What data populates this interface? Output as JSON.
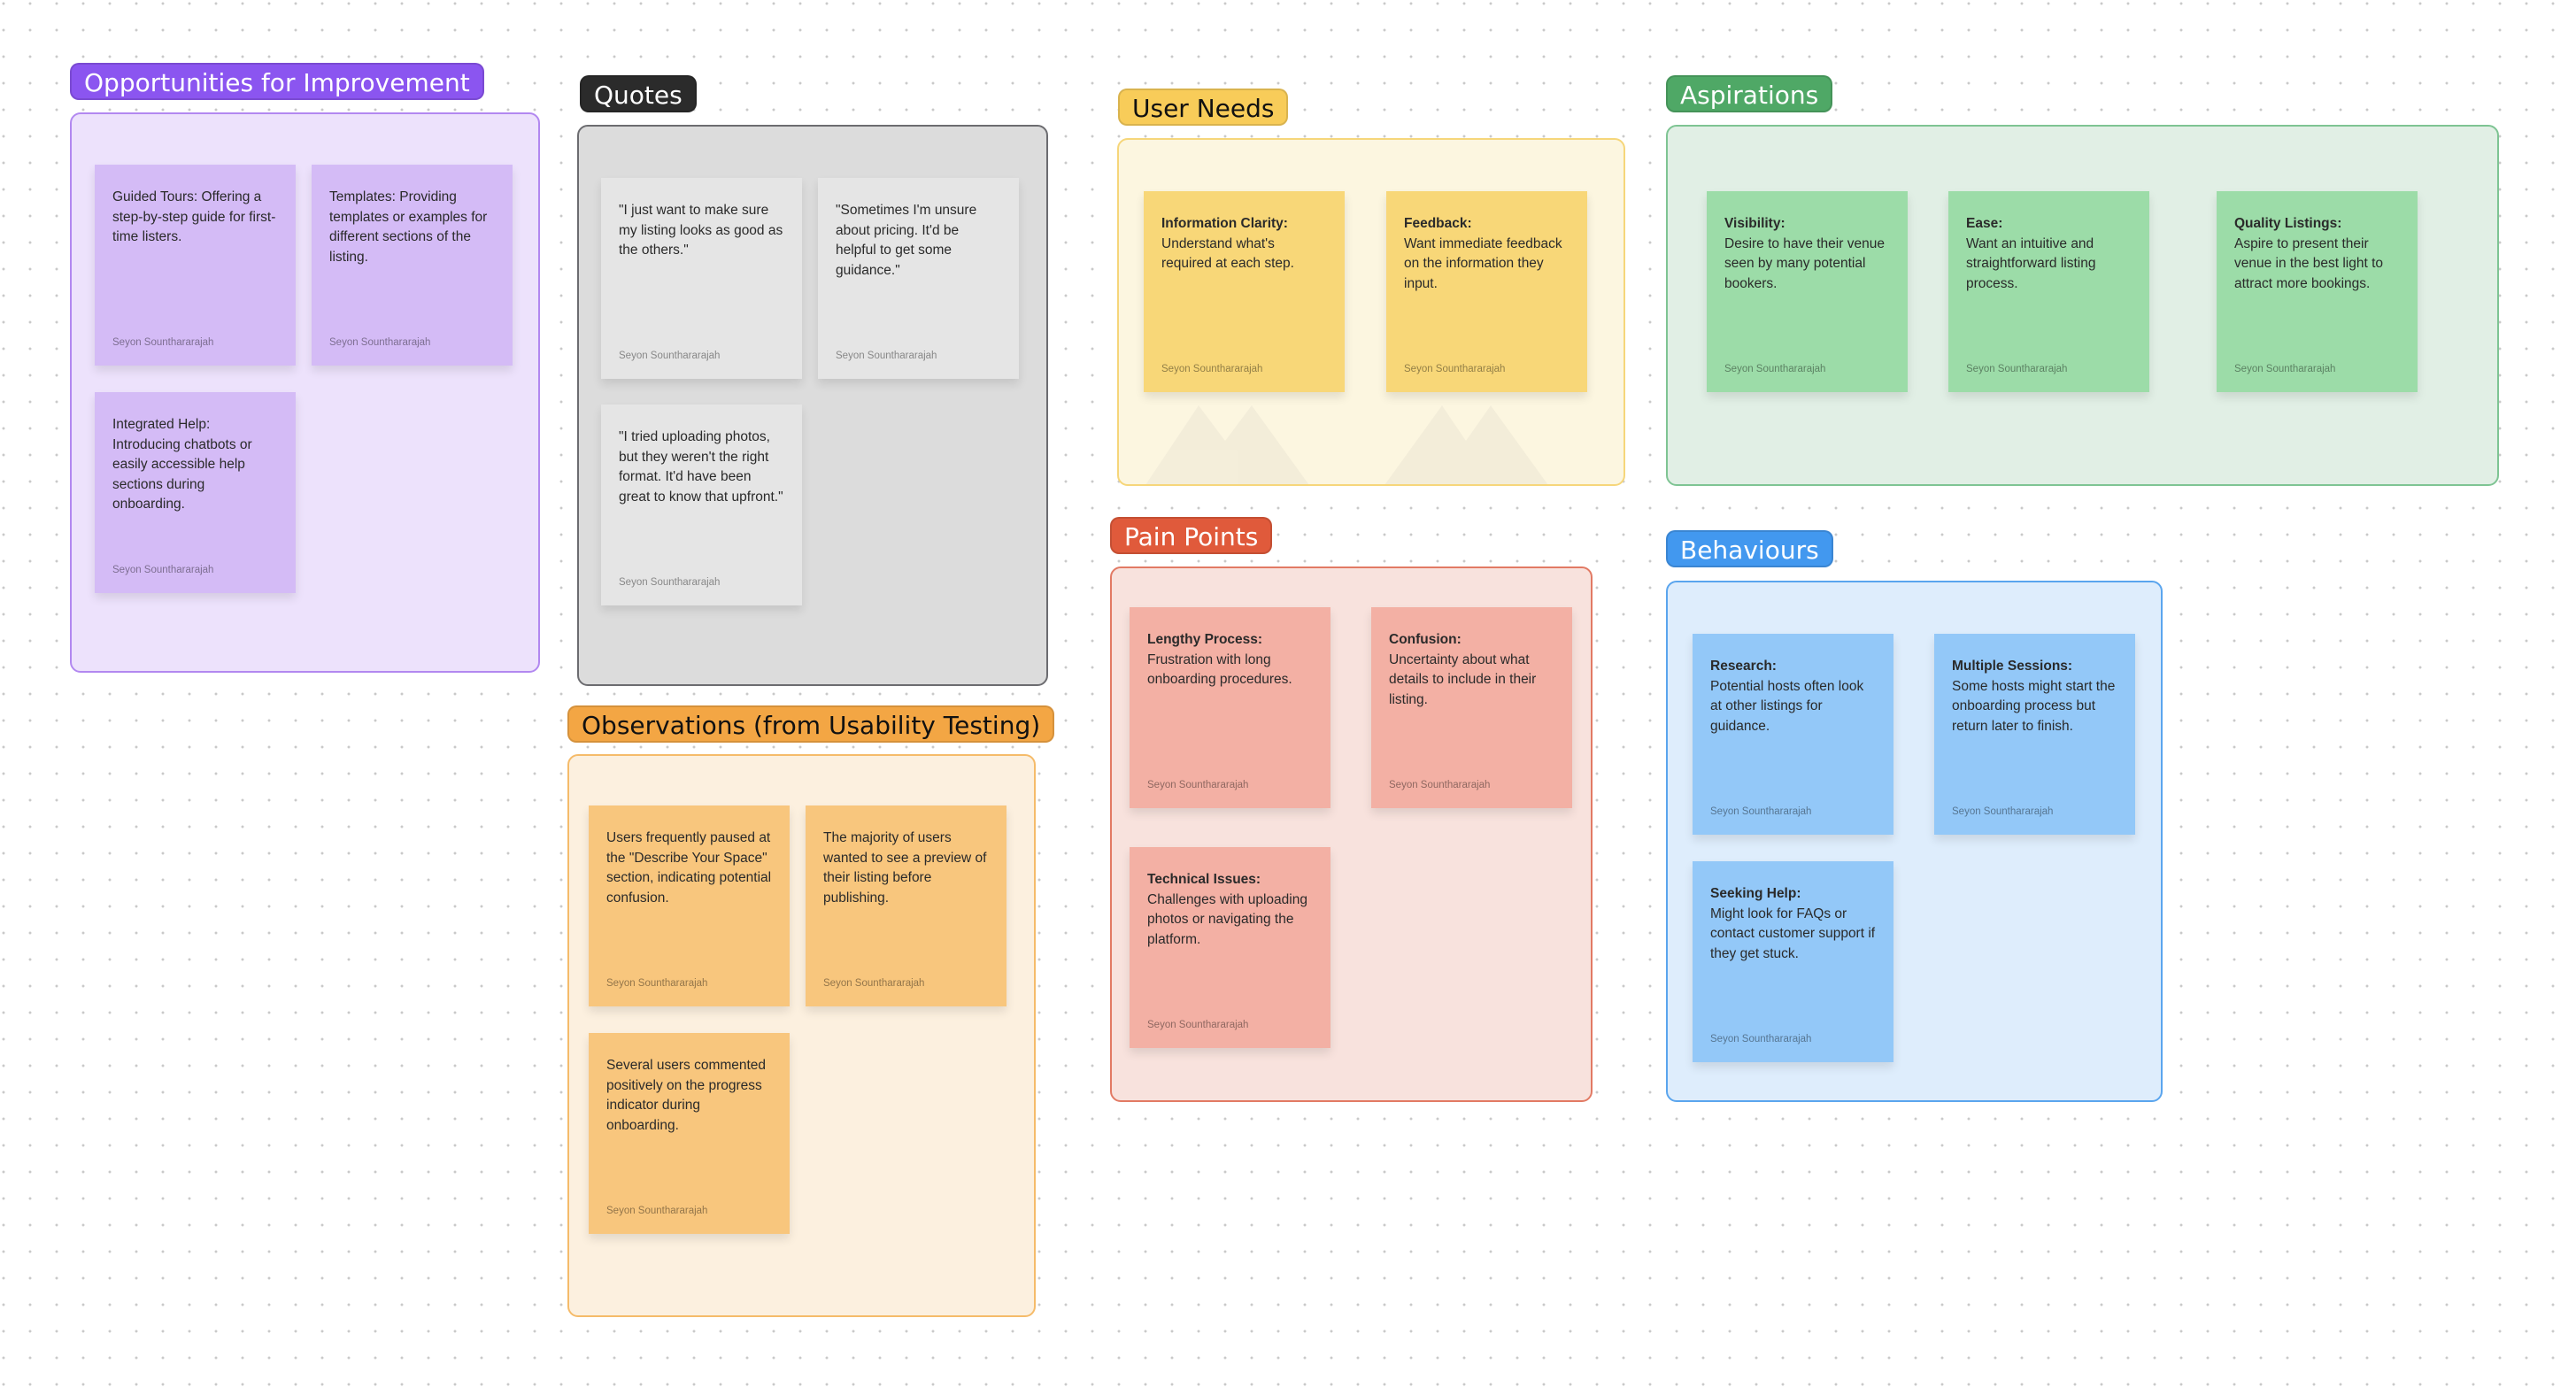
{
  "board": {
    "sections": {
      "opportunities": {
        "title": "Opportunities for Improvement",
        "color": "#8b55f0",
        "notes": [
          {
            "text": "Guided Tours: Offering a step-by-step guide for first-time listers.",
            "author": "Seyon Sounthararajah"
          },
          {
            "text": "Templates: Providing templates or examples for different sections of the listing.",
            "author": "Seyon Sounthararajah"
          },
          {
            "text": "Integrated Help: Introducing chatbots or easily accessible help sections during onboarding.",
            "author": "Seyon Sounthararajah"
          }
        ]
      },
      "quotes": {
        "title": "Quotes",
        "color": "#2b2b2b",
        "notes": [
          {
            "text": "\"I just want to make sure my listing looks as good as the others.\"",
            "author": "Seyon Sounthararajah"
          },
          {
            "text": "\"Sometimes I'm unsure about pricing. It'd be helpful to get some guidance.\"",
            "author": "Seyon Sounthararajah"
          },
          {
            "text": "\"I tried uploading photos, but they weren't the right format. It'd have been great to know that upfront.\"",
            "author": "Seyon Sounthararajah"
          }
        ]
      },
      "observations": {
        "title": "Observations (from Usability Testing)",
        "color": "#f3a644",
        "notes": [
          {
            "text": "Users frequently paused at the \"Describe Your Space\" section, indicating potential confusion.",
            "author": "Seyon Sounthararajah"
          },
          {
            "text": "The majority of users wanted to see a preview of their listing before publishing.",
            "author": "Seyon Sounthararajah"
          },
          {
            "text": "Several users commented positively on the progress indicator during onboarding.",
            "author": "Seyon Sounthararajah"
          }
        ]
      },
      "user_needs": {
        "title": "User Needs",
        "color": "#f8cc59",
        "notes": [
          {
            "heading": "Information Clarity:",
            "text": "Understand what's required at each step.",
            "author": "Seyon Sounthararajah"
          },
          {
            "heading": "Feedback:",
            "text": "Want immediate feedback on the information they input.",
            "author": "Seyon Sounthararajah"
          }
        ]
      },
      "pain_points": {
        "title": "Pain Points",
        "color": "#e05a3b",
        "notes": [
          {
            "heading": "Lengthy Process:",
            "text": "Frustration with long onboarding procedures.",
            "author": "Seyon Sounthararajah"
          },
          {
            "heading": "Confusion:",
            "text": "Uncertainty about what details to include in their listing.",
            "author": "Seyon Sounthararajah"
          },
          {
            "heading": "Technical Issues:",
            "text": "Challenges with uploading photos or navigating the platform.",
            "author": "Seyon Sounthararajah"
          }
        ]
      },
      "aspirations": {
        "title": "Aspirations",
        "color": "#4fa866",
        "notes": [
          {
            "heading": "Visibility:",
            "text": "Desire to have their venue seen by many potential bookers.",
            "author": "Seyon Sounthararajah"
          },
          {
            "heading": "Ease:",
            "text": "Want an intuitive and straightforward listing process.",
            "author": "Seyon Sounthararajah"
          },
          {
            "heading": "Quality Listings:",
            "text": "Aspire to present their venue in the best light to attract more bookings.",
            "author": "Seyon Sounthararajah"
          }
        ]
      },
      "behaviours": {
        "title": "Behaviours",
        "color": "#4298ef",
        "notes": [
          {
            "heading": "Research:",
            "text": "Potential hosts often look at other listings for guidance.",
            "author": "Seyon Sounthararajah"
          },
          {
            "heading": "Multiple Sessions:",
            "text": "Some hosts might start the onboarding process but return later to finish.",
            "author": "Seyon Sounthararajah"
          },
          {
            "heading": "Seeking Help:",
            "text": "Might look for FAQs or contact customer support if they get stuck.",
            "author": "Seyon Sounthararajah"
          }
        ]
      }
    }
  }
}
